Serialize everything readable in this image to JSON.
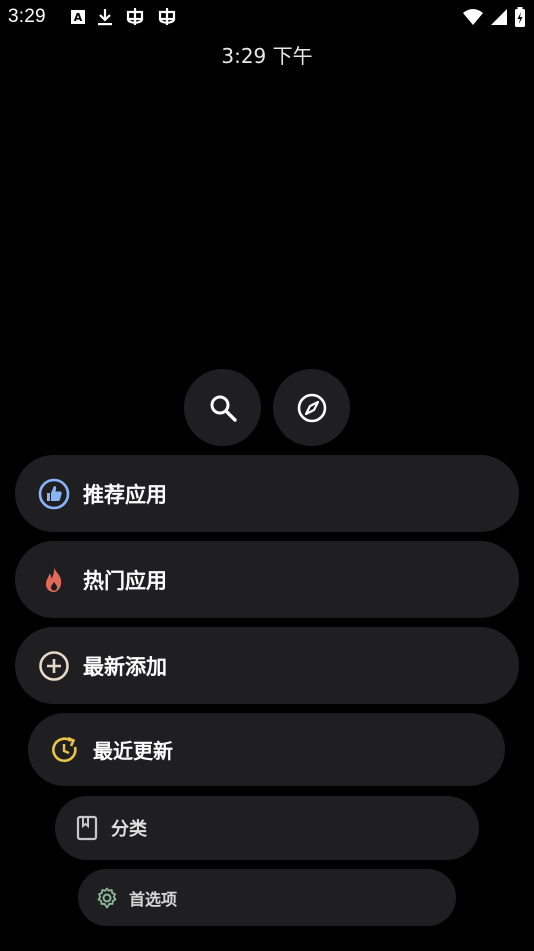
{
  "status_bar": {
    "time": "3:29",
    "left_icons": [
      "text-a-icon",
      "download-icon",
      "bug-icon",
      "bug-icon"
    ],
    "right_icons": [
      "wifi-icon",
      "signal-icon",
      "battery-charging-icon"
    ]
  },
  "clock": {
    "text": "3:29 下午"
  },
  "actions": {
    "search_icon": "search-icon",
    "explore_icon": "compass-icon"
  },
  "menu": {
    "items": [
      {
        "label": "推荐应用",
        "icon": "thumb-up-icon",
        "icon_color": "#8ab4f8"
      },
      {
        "label": "热门应用",
        "icon": "fire-icon",
        "icon_color": "#e06b5a"
      },
      {
        "label": "最新添加",
        "icon": "plus-circle-icon",
        "icon_color": "#e8d8c8"
      },
      {
        "label": "最近更新",
        "icon": "refresh-clock-icon",
        "icon_color": "#e8c547"
      },
      {
        "label": "分类",
        "icon": "book-icon",
        "icon_color": "#c8c8c8"
      },
      {
        "label": "首选项",
        "icon": "gear-icon",
        "icon_color": "#8fb89a"
      }
    ]
  },
  "colors": {
    "background": "#000000",
    "surface": "#1f1f21",
    "text": "#ffffff"
  }
}
